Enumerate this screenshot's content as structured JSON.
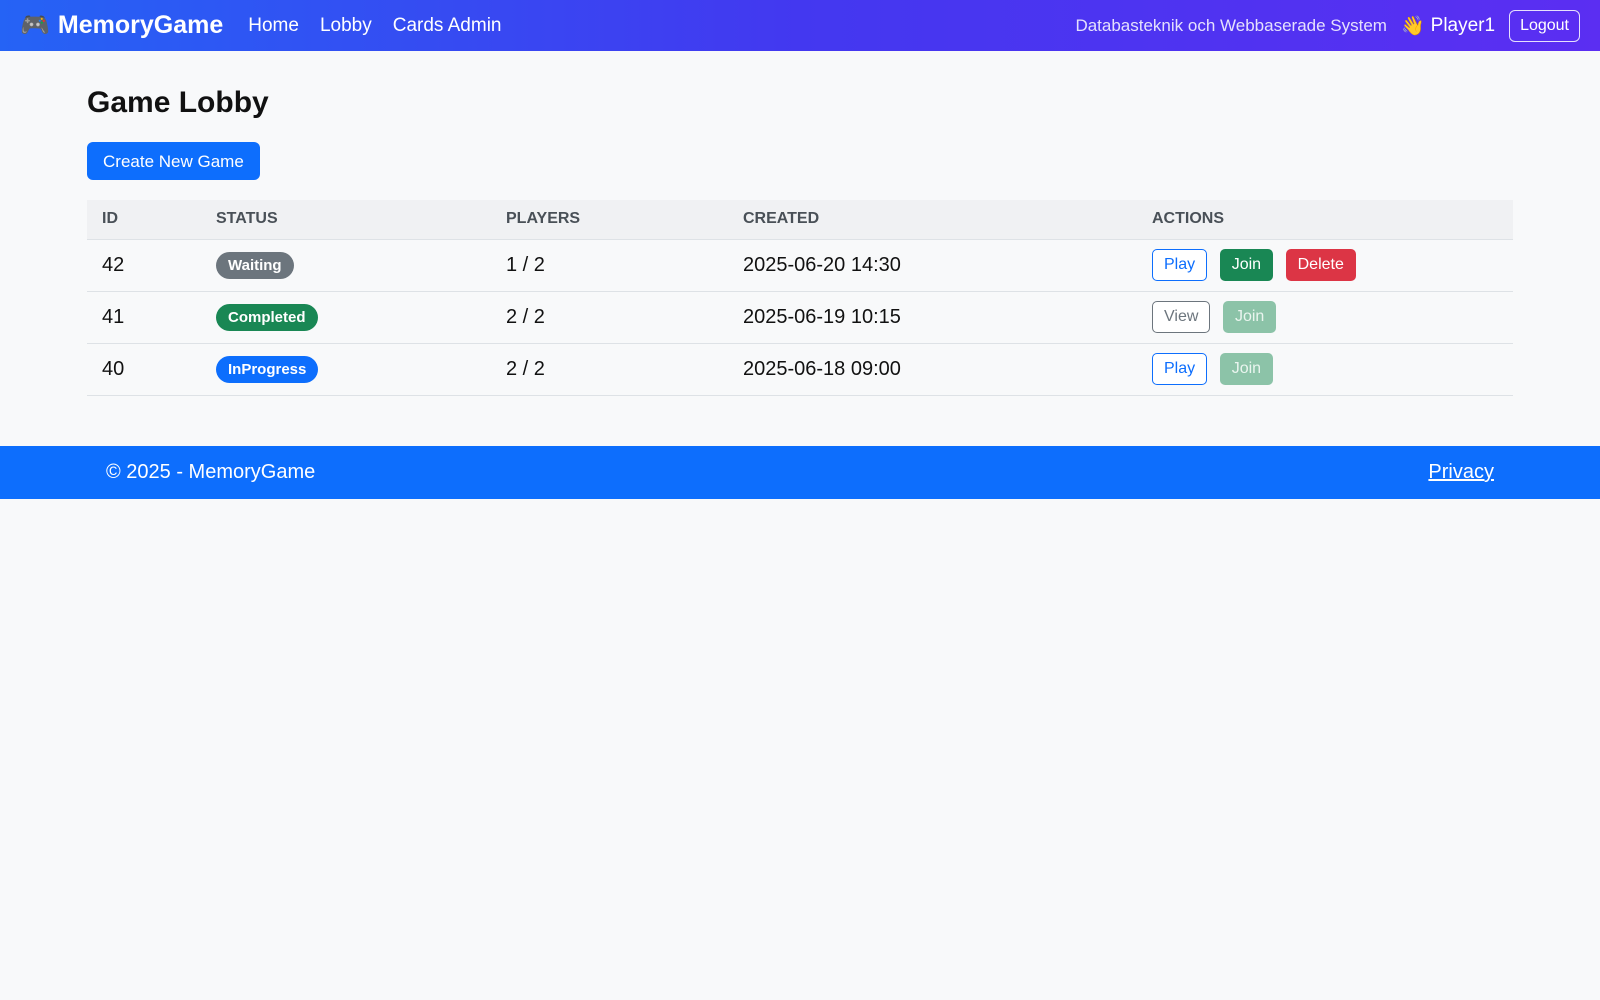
{
  "nav": {
    "brand_icon": "gamepad-icon",
    "brand_emoji": "🎮",
    "brand": "MemoryGame",
    "links": [
      "Home",
      "Lobby",
      "Cards Admin"
    ],
    "course": "Databasteknik och Webbaserade System",
    "wave_emoji": "👋",
    "user": "Player1",
    "logout": "Logout"
  },
  "page": {
    "title": "Game Lobby",
    "create_button": "Create New Game"
  },
  "table": {
    "headers": [
      "ID",
      "STATUS",
      "PLAYERS",
      "CREATED",
      "ACTIONS"
    ],
    "rows": [
      {
        "id": "42",
        "status": "Waiting",
        "players": "1 / 2",
        "created": "2025-06-20 14:30",
        "actions": [
          {
            "label": "Play",
            "style": "outline-primary",
            "enabled": true
          },
          {
            "label": "Join",
            "style": "success",
            "enabled": true
          },
          {
            "label": "Delete",
            "style": "danger",
            "enabled": true
          }
        ]
      },
      {
        "id": "41",
        "status": "Completed",
        "players": "2 / 2",
        "created": "2025-06-19 10:15",
        "actions": [
          {
            "label": "View",
            "style": "outline-secondary",
            "enabled": true
          },
          {
            "label": "Join",
            "style": "success",
            "enabled": false
          }
        ]
      },
      {
        "id": "40",
        "status": "InProgress",
        "players": "2 / 2",
        "created": "2025-06-18 09:00",
        "actions": [
          {
            "label": "Play",
            "style": "outline-primary",
            "enabled": true
          },
          {
            "label": "Join",
            "style": "success",
            "enabled": false
          }
        ]
      }
    ]
  },
  "footer": {
    "copyright": "© 2025 - MemoryGame",
    "privacy": "Privacy"
  },
  "colors": {
    "primary": "#0d6efd",
    "success": "#198754",
    "danger": "#dc3545",
    "secondary": "#6c757d"
  }
}
